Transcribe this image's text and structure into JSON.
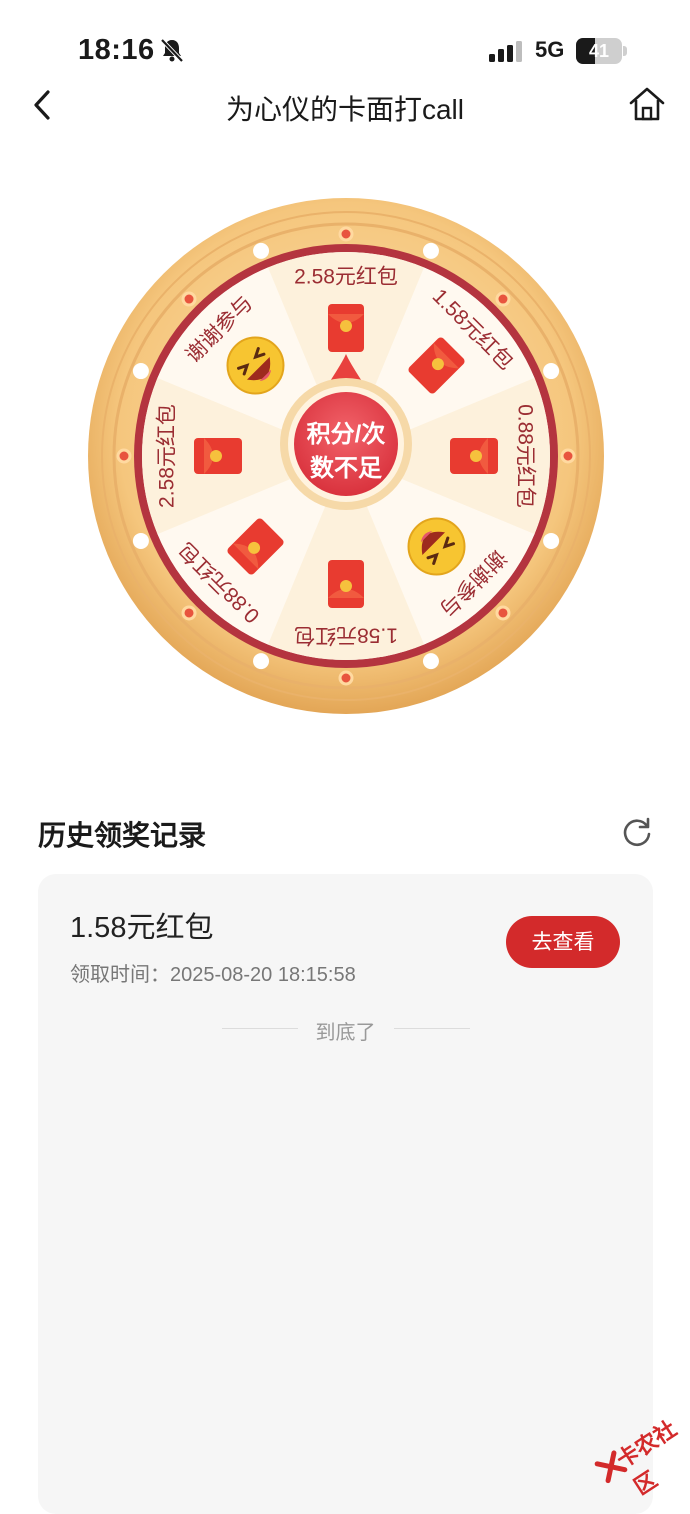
{
  "status_bar": {
    "time": "18:16",
    "network": "5G",
    "battery_level": "41"
  },
  "nav": {
    "title": "为心仪的卡面打call"
  },
  "wheel": {
    "center_text_line1": "积分/次",
    "center_text_line2": "数不足",
    "segments": [
      {
        "label": "2.58元红包",
        "icon": "red-envelope-icon"
      },
      {
        "label": "1.58元红包",
        "icon": "red-envelope-icon"
      },
      {
        "label": "0.88元红包",
        "icon": "red-envelope-icon"
      },
      {
        "label": "谢谢参与",
        "icon": "laughing-face-icon"
      },
      {
        "label": "1.58元红包",
        "icon": "red-envelope-icon"
      },
      {
        "label": "0.88元红包",
        "icon": "red-envelope-icon"
      },
      {
        "label": "2.58元红包",
        "icon": "red-envelope-icon"
      },
      {
        "label": "谢谢参与",
        "icon": "laughing-face-icon"
      }
    ],
    "colors": {
      "rim": "#f2c57d",
      "rim_dark": "#e2a44f",
      "band": "#b4343f",
      "light_segment": "#fdf1dc",
      "white_segment": "#fff9f0",
      "label": "#9b2d33",
      "pointer": "#e8413e"
    }
  },
  "history": {
    "title": "历史领奖记录",
    "records": [
      {
        "prize": "1.58元红包",
        "time_label": "领取时间：2025-08-20 18:15:58",
        "action": "去查看"
      }
    ],
    "end_text": "到底了"
  },
  "watermark": {
    "text": "卡农社区"
  }
}
